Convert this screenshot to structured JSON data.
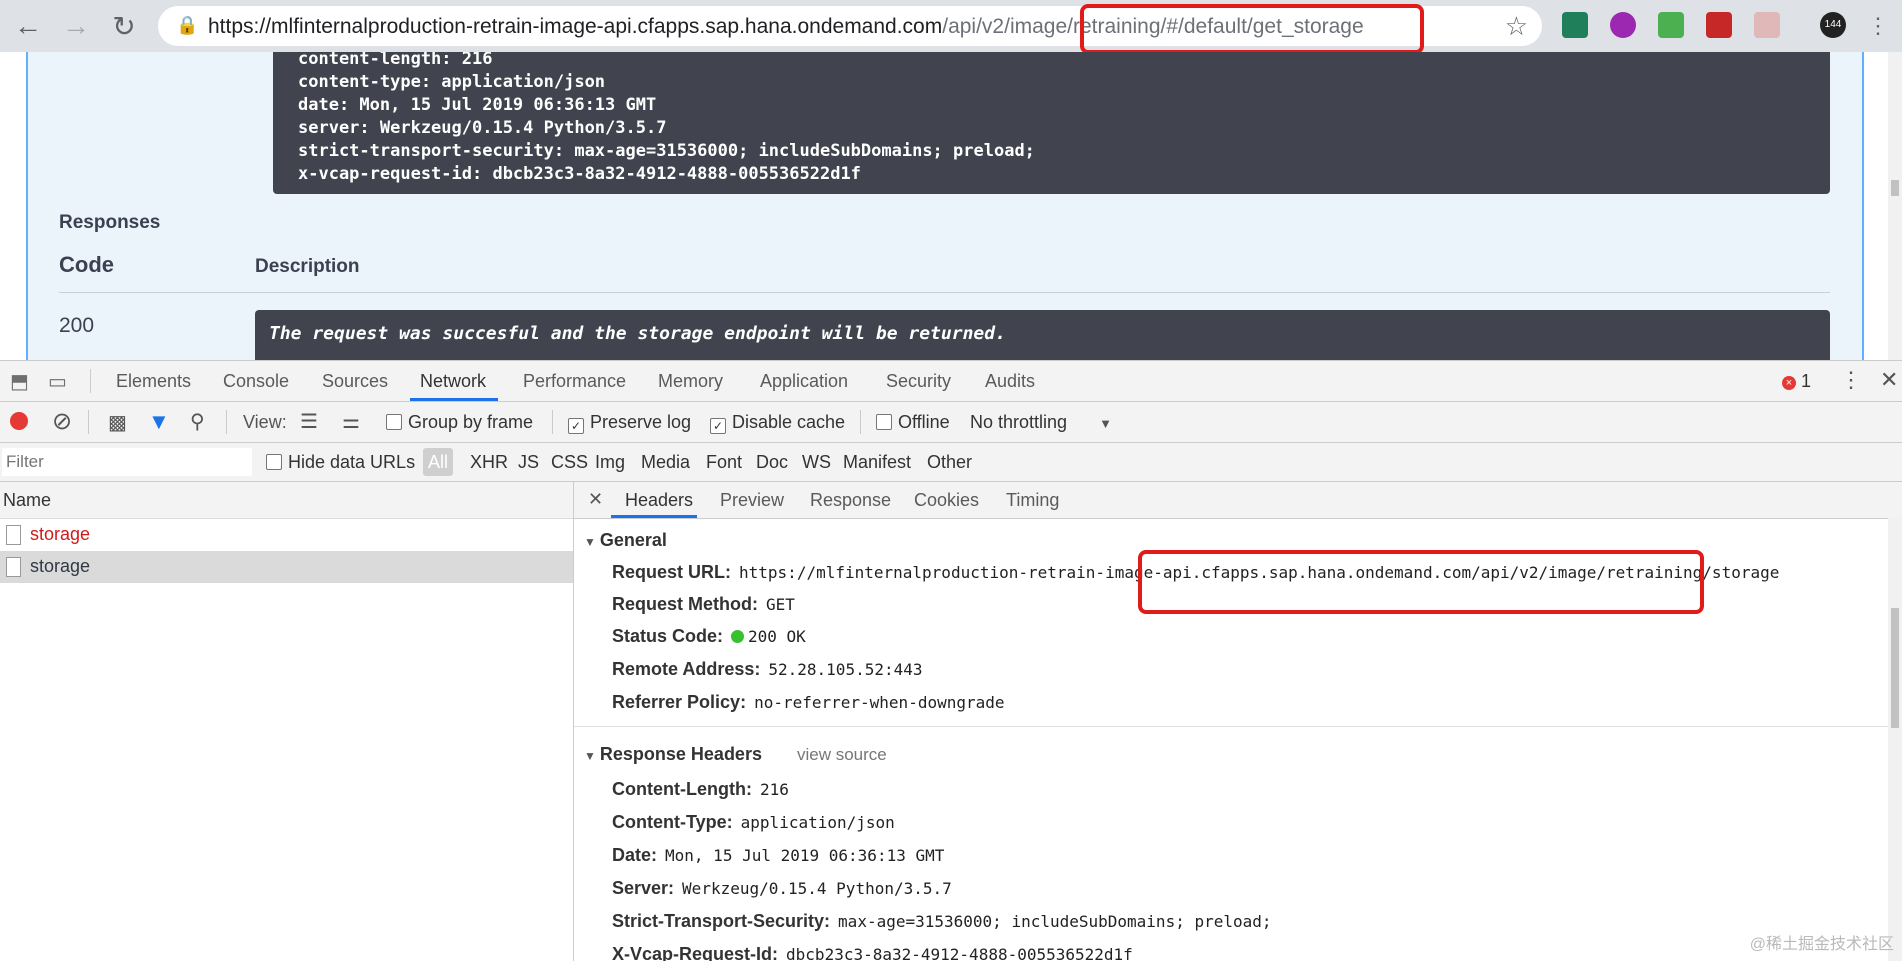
{
  "browser": {
    "url_main": "https://mlfinternalproduction-retrain-image-api.cfapps.sap.hana.ondemand.com",
    "url_path": "/api/v2/image/retraining/#/default/get_storage",
    "ext_badge": "144"
  },
  "page": {
    "headers_text": "content-length: 216\ncontent-type: application/json\ndate: Mon, 15 Jul 2019 06:36:13 GMT\nserver: Werkzeug/0.15.4 Python/3.5.7\nstrict-transport-security: max-age=31536000; includeSubDomains; preload;\nx-vcap-request-id: dbcb23c3-8a32-4912-4888-005536522d1f",
    "responses_title": "Responses",
    "code_header": "Code",
    "description_header": "Description",
    "code_200": "200",
    "description_200": "The request was succesful and the storage endpoint will be returned."
  },
  "devtools": {
    "tabs": [
      "Elements",
      "Console",
      "Sources",
      "Network",
      "Performance",
      "Memory",
      "Application",
      "Security",
      "Audits"
    ],
    "active_tab": "Network",
    "error_count": "1",
    "controls": {
      "view_label": "View:",
      "group_by_frame": "Group by frame",
      "preserve_log": "Preserve log",
      "disable_cache": "Disable cache",
      "offline": "Offline",
      "throttling": "No throttling"
    },
    "filter": {
      "placeholder": "Filter",
      "hide_data_urls": "Hide data URLs",
      "types": [
        "All",
        "XHR",
        "JS",
        "CSS",
        "Img",
        "Media",
        "Font",
        "Doc",
        "WS",
        "Manifest",
        "Other"
      ]
    },
    "requests": {
      "column_name": "Name",
      "rows": [
        {
          "name": "storage",
          "status": "error"
        },
        {
          "name": "storage",
          "status": "selected"
        }
      ]
    },
    "detail": {
      "tabs": [
        "Headers",
        "Preview",
        "Response",
        "Cookies",
        "Timing"
      ],
      "active_tab": "Headers",
      "general_title": "General",
      "general": {
        "request_url_label": "Request URL:",
        "request_url": "https://mlfinternalproduction-retrain-image-api.cfapps.sap.hana.ondemand.com/api/v2/image/retraining/storage",
        "request_method_label": "Request Method:",
        "request_method": "GET",
        "status_code_label": "Status Code:",
        "status_code": "200 OK",
        "remote_address_label": "Remote Address:",
        "remote_address": "52.28.105.52:443",
        "referrer_policy_label": "Referrer Policy:",
        "referrer_policy": "no-referrer-when-downgrade"
      },
      "response_headers_title": "Response Headers",
      "view_source": "view source",
      "response_headers": [
        {
          "key": "Content-Length:",
          "value": "216"
        },
        {
          "key": "Content-Type:",
          "value": "application/json"
        },
        {
          "key": "Date:",
          "value": "Mon, 15 Jul 2019 06:36:13 GMT"
        },
        {
          "key": "Server:",
          "value": "Werkzeug/0.15.4 Python/3.5.7"
        },
        {
          "key": "Strict-Transport-Security:",
          "value": "max-age=31536000; includeSubDomains; preload;"
        },
        {
          "key": "X-Vcap-Request-Id:",
          "value": "dbcb23c3-8a32-4912-4888-005536522d1f"
        }
      ]
    }
  },
  "watermark": "@稀土掘金技术社区",
  "colors": {
    "highlight": "#e11a1a",
    "active_tab": "#1a73e8",
    "status_ok": "#36c22f",
    "error_text": "#d01b1b"
  }
}
